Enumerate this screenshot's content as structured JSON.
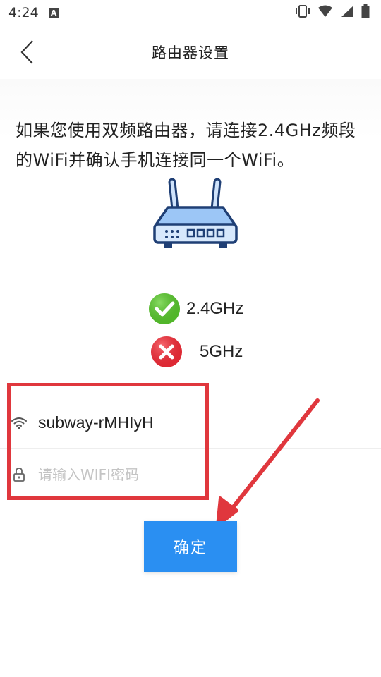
{
  "status_bar": {
    "time": "4:24",
    "notification_letter": "A"
  },
  "header": {
    "title": "路由器设置"
  },
  "intro": {
    "text": "如果您使用双频路由器，请连接2.4GHz频段的WiFi并确认手机连接同一个WiFi。"
  },
  "bands": [
    {
      "label": "2.4GHz",
      "status": "supported",
      "icon": "check-circle-icon",
      "color": "#52b82a"
    },
    {
      "label": "5GHz",
      "status": "unsupported",
      "icon": "cross-circle-icon",
      "color": "#e02a35"
    }
  ],
  "form": {
    "ssid": "subway-rMHIyH",
    "password_placeholder": "请输入WIFI密码",
    "password_value": ""
  },
  "confirm_button": {
    "label": "确定",
    "color": "#2a8ff2"
  },
  "annotation": {
    "color": "#e0373d"
  }
}
